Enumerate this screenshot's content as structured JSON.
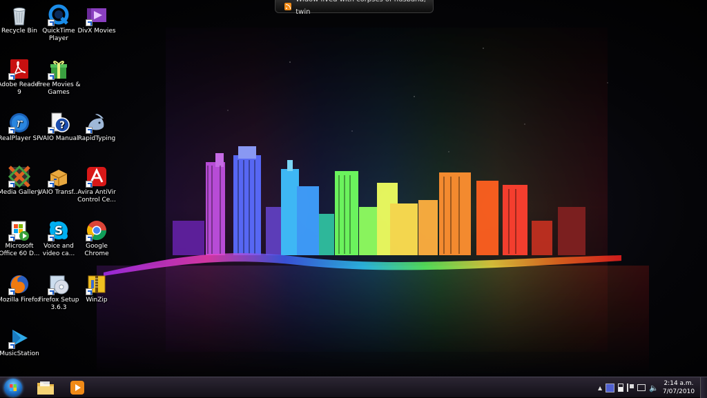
{
  "feed": {
    "headline": "Widow lived with corpses of husband, twin",
    "icon": "rss-icon"
  },
  "desktop_icons": [
    {
      "label": "Recycle Bin",
      "icon": "recycle-bin-icon"
    },
    {
      "label": "QuickTime Player",
      "icon": "quicktime-icon"
    },
    {
      "label": "DivX Movies",
      "icon": "divx-movies-icon"
    },
    {
      "label": "Adobe Reader 9",
      "icon": "adobe-reader-icon"
    },
    {
      "label": "Free Movies & Games",
      "icon": "gift-box-icon"
    },
    {
      "label": "RealPlayer SP",
      "icon": "realplayer-icon"
    },
    {
      "label": "VAIO Manual",
      "icon": "vaio-manual-icon"
    },
    {
      "label": "RapidTyping",
      "icon": "rapidtyping-icon"
    },
    {
      "label": "Media Gallery",
      "icon": "media-gallery-icon"
    },
    {
      "label": "VAIO Transf...",
      "icon": "vaio-transfer-icon"
    },
    {
      "label": "Avira AntiVir Control Ce...",
      "icon": "avira-icon"
    },
    {
      "label": "Microsoft Office 60 D...",
      "icon": "office-trial-icon"
    },
    {
      "label": "Voice and video ca...",
      "icon": "skype-icon"
    },
    {
      "label": "Google Chrome",
      "icon": "chrome-icon"
    },
    {
      "label": "Mozilla Firefox",
      "icon": "firefox-icon"
    },
    {
      "label": "Firefox Setup 3.6.3",
      "icon": "firefox-setup-icon"
    },
    {
      "label": "WinZip",
      "icon": "winzip-icon"
    },
    {
      "label": "MusicStation",
      "icon": "musicstation-icon"
    }
  ],
  "taskbar": {
    "start_icon": "windows-start-icon",
    "pinned": [
      {
        "name": "Windows Explorer",
        "icon": "folder-icon"
      },
      {
        "name": "Windows Media Player",
        "icon": "media-player-icon"
      }
    ],
    "tray_icons": [
      "tray-chevron-icon",
      "tray-app-icon",
      "tray-battery-icon",
      "tray-flag-icon",
      "tray-network-icon",
      "tray-volume-icon"
    ],
    "clock": {
      "time": "2:14 a.m.",
      "date": "7/07/2010"
    }
  },
  "colors": {
    "taskbar": "#1c1822",
    "accent": "#1d6fc7",
    "rss": "#f08a17"
  }
}
